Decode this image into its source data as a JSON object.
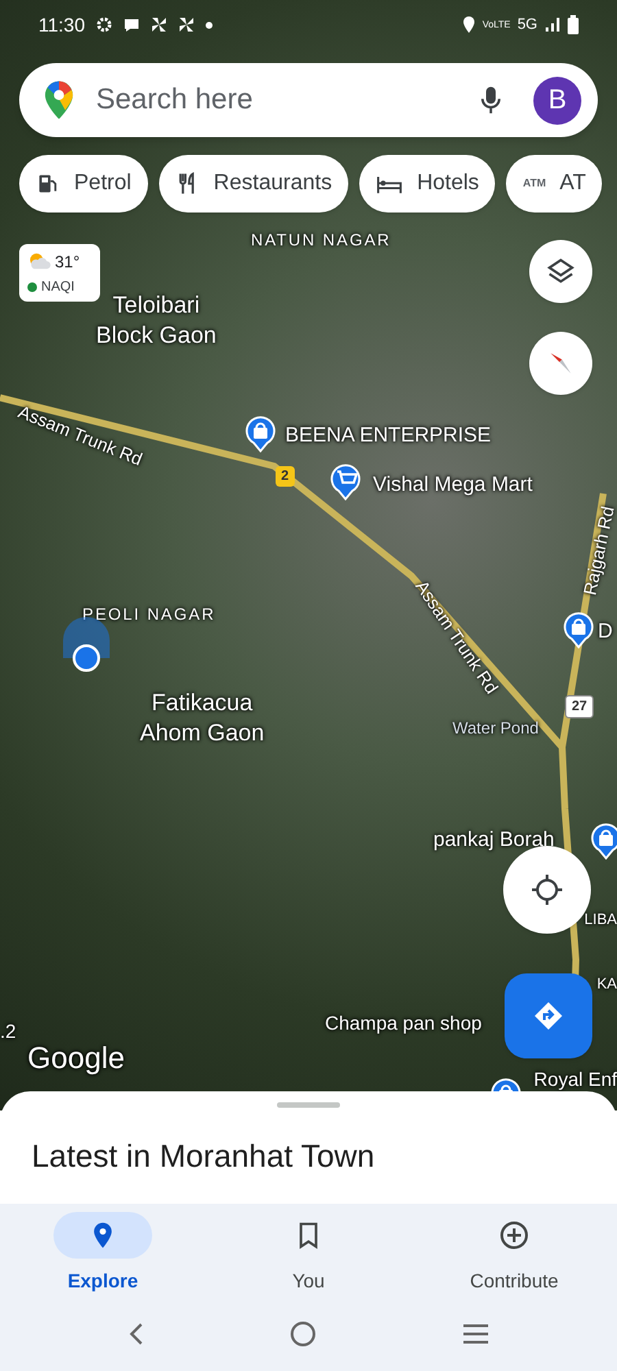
{
  "status_bar": {
    "time": "11:30",
    "network_label": "VoLTE",
    "network": "5G"
  },
  "search": {
    "placeholder": "Search here",
    "avatar_letter": "B"
  },
  "chips": [
    {
      "kind": "petrol",
      "label": "Petrol"
    },
    {
      "kind": "restaurants",
      "label": "Restaurants"
    },
    {
      "kind": "hotels",
      "label": "Hotels"
    },
    {
      "kind": "atm",
      "icon_text": "ATM",
      "label": "AT"
    }
  ],
  "weather": {
    "temperature": "31°",
    "aqi_label": "NAQI"
  },
  "map": {
    "labels": [
      {
        "kind": "area",
        "text": "NATUN NAGAR"
      },
      {
        "kind": "place",
        "text": "Teloibari\nBlock Gaon"
      },
      {
        "kind": "road",
        "text": "Assam Trunk Rd"
      },
      {
        "kind": "road",
        "text": "Rajgarh Rd"
      },
      {
        "kind": "area",
        "text": "PEOLI NAGAR"
      },
      {
        "kind": "road",
        "text": "Assam Trunk Rd"
      },
      {
        "kind": "place",
        "text": "Fatikacua\nAhom Gaon"
      },
      {
        "kind": "water",
        "text": "Water Pond"
      },
      {
        "kind": "poi",
        "text": ".2"
      },
      {
        "kind": "poi",
        "text": "Champa pan shop"
      },
      {
        "kind": "area",
        "text": "LIBA"
      },
      {
        "kind": "area",
        "text": "KA"
      }
    ],
    "pins": [
      {
        "kind": "store",
        "label": "BEENA ENTERPRISE"
      },
      {
        "kind": "cart",
        "label": "Vishal Mega Mart"
      },
      {
        "kind": "store",
        "label": "D"
      },
      {
        "kind": "store",
        "label": "pankaj Borah"
      },
      {
        "kind": "store",
        "label": "Royal Enf"
      }
    ],
    "shields": [
      "2",
      "27"
    ],
    "attribution": "Google"
  },
  "sheet": {
    "title": "Latest in Moranhat Town"
  },
  "bottom_nav": [
    {
      "kind": "explore",
      "label": "Explore",
      "selected": true
    },
    {
      "kind": "you",
      "label": "You",
      "selected": false
    },
    {
      "kind": "contribute",
      "label": "Contribute",
      "selected": false
    }
  ]
}
